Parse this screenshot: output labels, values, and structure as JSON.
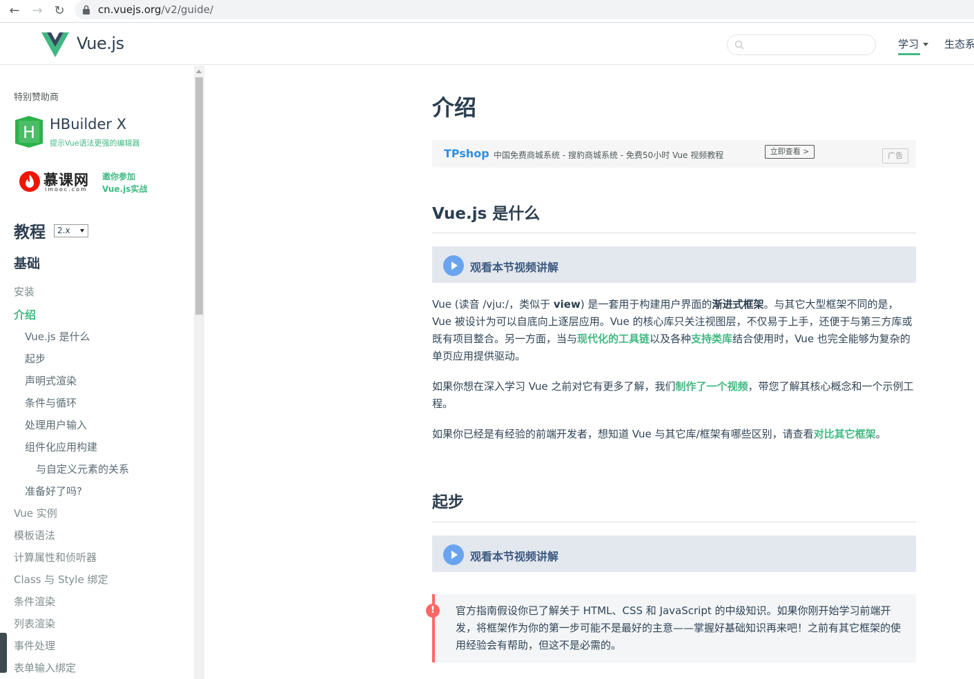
{
  "browser": {
    "url_host": "cn.vuejs.org",
    "url_path": "/v2/guide/"
  },
  "header": {
    "logo_text": "Vue.js",
    "nav_learn": "学习",
    "nav_ecosystem": "生态系"
  },
  "sidebar": {
    "sponsor_label": "特别赞助商",
    "hbuilder_title": "HBuilder X",
    "hbuilder_sub": "提示Vue语法更强的编辑器",
    "imooc_name": "慕课网",
    "imooc_domain": "imooc.com",
    "imooc_line1": "邀你参加",
    "imooc_line2": "Vue.js实战",
    "tutorial_title": "教程",
    "version": "2.x",
    "section_basics": "基础",
    "items": [
      {
        "label": "安装",
        "level": 0
      },
      {
        "label": "介绍",
        "level": 0,
        "active": true
      },
      {
        "label": "Vue.js 是什么",
        "level": 1
      },
      {
        "label": "起步",
        "level": 1
      },
      {
        "label": "声明式渲染",
        "level": 1
      },
      {
        "label": "条件与循环",
        "level": 1
      },
      {
        "label": "处理用户输入",
        "level": 1
      },
      {
        "label": "组件化应用构建",
        "level": 1
      },
      {
        "label": "与自定义元素的关系",
        "level": 2
      },
      {
        "label": "准备好了吗?",
        "level": 1
      },
      {
        "label": "Vue 实例",
        "level": 0
      },
      {
        "label": "模板语法",
        "level": 0
      },
      {
        "label": "计算属性和侦听器",
        "level": 0
      },
      {
        "label": "Class 与 Style 绑定",
        "level": 0
      },
      {
        "label": "条件渲染",
        "level": 0
      },
      {
        "label": "列表渲染",
        "level": 0
      },
      {
        "label": "事件处理",
        "level": 0
      },
      {
        "label": "表单输入绑定",
        "level": 0
      }
    ]
  },
  "main": {
    "title": "介绍",
    "ad": {
      "brand": "TPshop",
      "text": "中国免费商城系统 - 搜豹商城系统 - 免费50小时 Vue 视频教程",
      "button": "立即查看 >",
      "tag": "广告"
    },
    "section1_title": "Vue.js 是什么",
    "video_label": "观看本节视频讲解",
    "p1": {
      "a": "Vue (读音 /vjuː/，类似于 ",
      "view": "view",
      "b": ") 是一套用于构建用户界面的",
      "progressive": "渐进式框架",
      "c": "。与其它大型框架不同的是，Vue 被设计为可以自底向上逐层应用。Vue 的核心库只关注视图层，不仅易于上手，还便于与第三方库或既有项目整合。另一方面，当与",
      "link1": "现代化的工具链",
      "d": "以及各种",
      "link2": "支持类库",
      "e": "结合使用时，Vue 也完全能够为复杂的单页应用提供驱动。"
    },
    "p2": {
      "a": "如果你想在深入学习 Vue 之前对它有更多了解，我们",
      "link": "制作了一个视频",
      "b": "，带您了解其核心概念和一个示例工程。"
    },
    "p3": {
      "a": "如果你已经是有经验的前端开发者，想知道 Vue 与其它库/框架有哪些区别，请查看",
      "link": "对比其它框架",
      "b": "。"
    },
    "section2_title": "起步",
    "video_label2": "观看本节视频讲解",
    "tip_icon": "!",
    "tip": "官方指南假设你已了解关于 HTML、CSS 和 JavaScript 的中级知识。如果你刚开始学习前端开发，将框架作为你的第一步可能不是最好的主意——掌握好基础知识再来吧！之前有其它框架的使用经验会有帮助，但这不是必需的。"
  }
}
